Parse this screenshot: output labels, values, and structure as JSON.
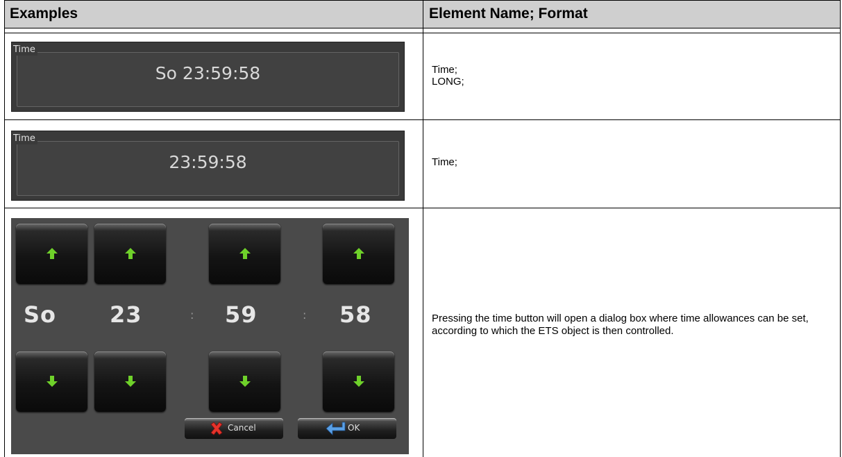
{
  "table": {
    "headers": {
      "examples": "Examples",
      "element_name": "Element Name; Format"
    },
    "rows": [
      {
        "widget": {
          "label": "Time",
          "value": "So 23:59:58"
        },
        "description_lines": [
          "Time;",
          "LONG;"
        ]
      },
      {
        "widget": {
          "label": "Time",
          "value": "23:59:58"
        },
        "description_lines": [
          "Time;"
        ]
      },
      {
        "dialog": {
          "day": "So",
          "hours": "23",
          "minutes": "59",
          "seconds": "58",
          "separator": ":",
          "cancel_label": "Cancel",
          "ok_label": "OK"
        },
        "description": "Pressing the time button will open a dialog box where time allowances can be set, according to which the ETS object is then controlled."
      }
    ]
  },
  "colors": {
    "arrow": "#6fd12a",
    "header_bg": "#cfcfcf",
    "panel_bg": "#3a3a3a"
  }
}
